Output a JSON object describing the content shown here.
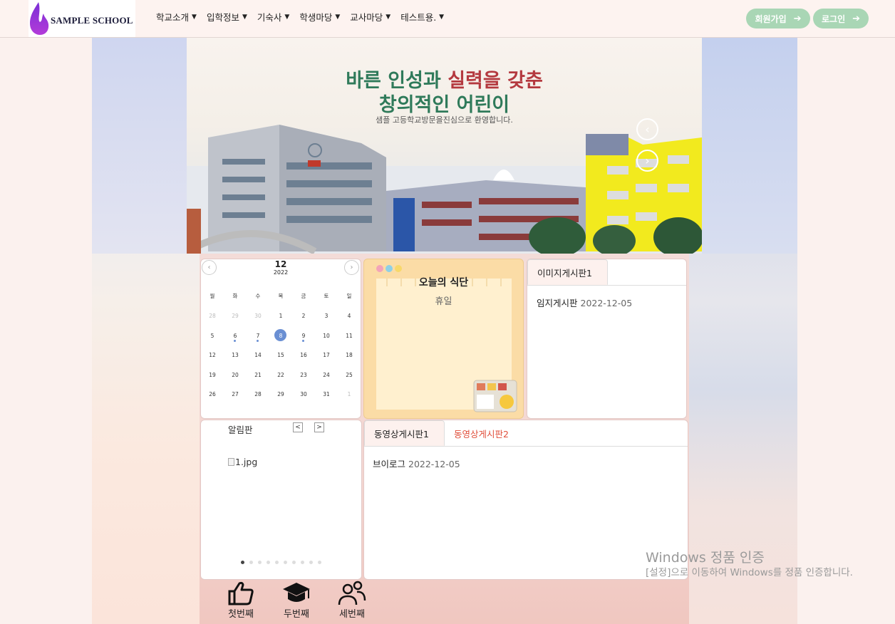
{
  "header": {
    "logo_text": "SAMPLE SCHOOL",
    "nav": [
      {
        "label": "학교소개"
      },
      {
        "label": "입학정보"
      },
      {
        "label": "기숙사"
      },
      {
        "label": "학생마당"
      },
      {
        "label": "교사마당"
      },
      {
        "label": "테스트용."
      }
    ],
    "signup_label": "회원가입",
    "login_label": "로그인"
  },
  "banner": {
    "slogan_part1": "바른 인성과 ",
    "slogan_part2": "실력을 갖춘",
    "slogan_line2": "창의적인 어린이",
    "slogan_sub": "샘플 고등학교방문을진심으로 환영합니다."
  },
  "calendar": {
    "month": "12",
    "year": "2022",
    "weekdays": [
      "월",
      "화",
      "수",
      "목",
      "금",
      "토",
      "일"
    ],
    "weeks": [
      [
        "28",
        "29",
        "30",
        "1",
        "2",
        "3",
        "4"
      ],
      [
        "5",
        "6",
        "7",
        "8",
        "9",
        "10",
        "11"
      ],
      [
        "12",
        "13",
        "14",
        "15",
        "16",
        "17",
        "18"
      ],
      [
        "19",
        "20",
        "21",
        "22",
        "23",
        "24",
        "25"
      ],
      [
        "26",
        "27",
        "28",
        "29",
        "30",
        "31",
        "1"
      ]
    ],
    "selected_day": "8"
  },
  "meal": {
    "title": "오늘의 식단",
    "body": "휴일"
  },
  "image_board": {
    "tab_label": "이미지게시판1",
    "post_title": "임지게시판",
    "post_date": "2022-12-05"
  },
  "notice": {
    "title": "알림판",
    "prev_label": "<",
    "next_label": ">",
    "image_alt": "1.jpg",
    "slide_count": 10,
    "active_slide": 1
  },
  "video_board": {
    "tab1_label": "동영상게시판1",
    "tab2_label": "동영상게시판2",
    "post_title": "브이로그",
    "post_date": "2022-12-05"
  },
  "quick_links": [
    {
      "label": "첫번째",
      "icon": "thumbs-up-icon"
    },
    {
      "label": "두번째",
      "icon": "graduation-cap-icon"
    },
    {
      "label": "세번째",
      "icon": "users-icon"
    }
  ],
  "watermark": {
    "line1": "Windows 정품 인증",
    "line2": "[설정]으로 이동하여 Windows를 정품 인증합니다."
  },
  "colors": {
    "brand_green": "#a9d6b5",
    "accent_red": "#e04e3a",
    "calendar_selected": "#6a8fd3",
    "meal_panel": "#fbdca6"
  }
}
